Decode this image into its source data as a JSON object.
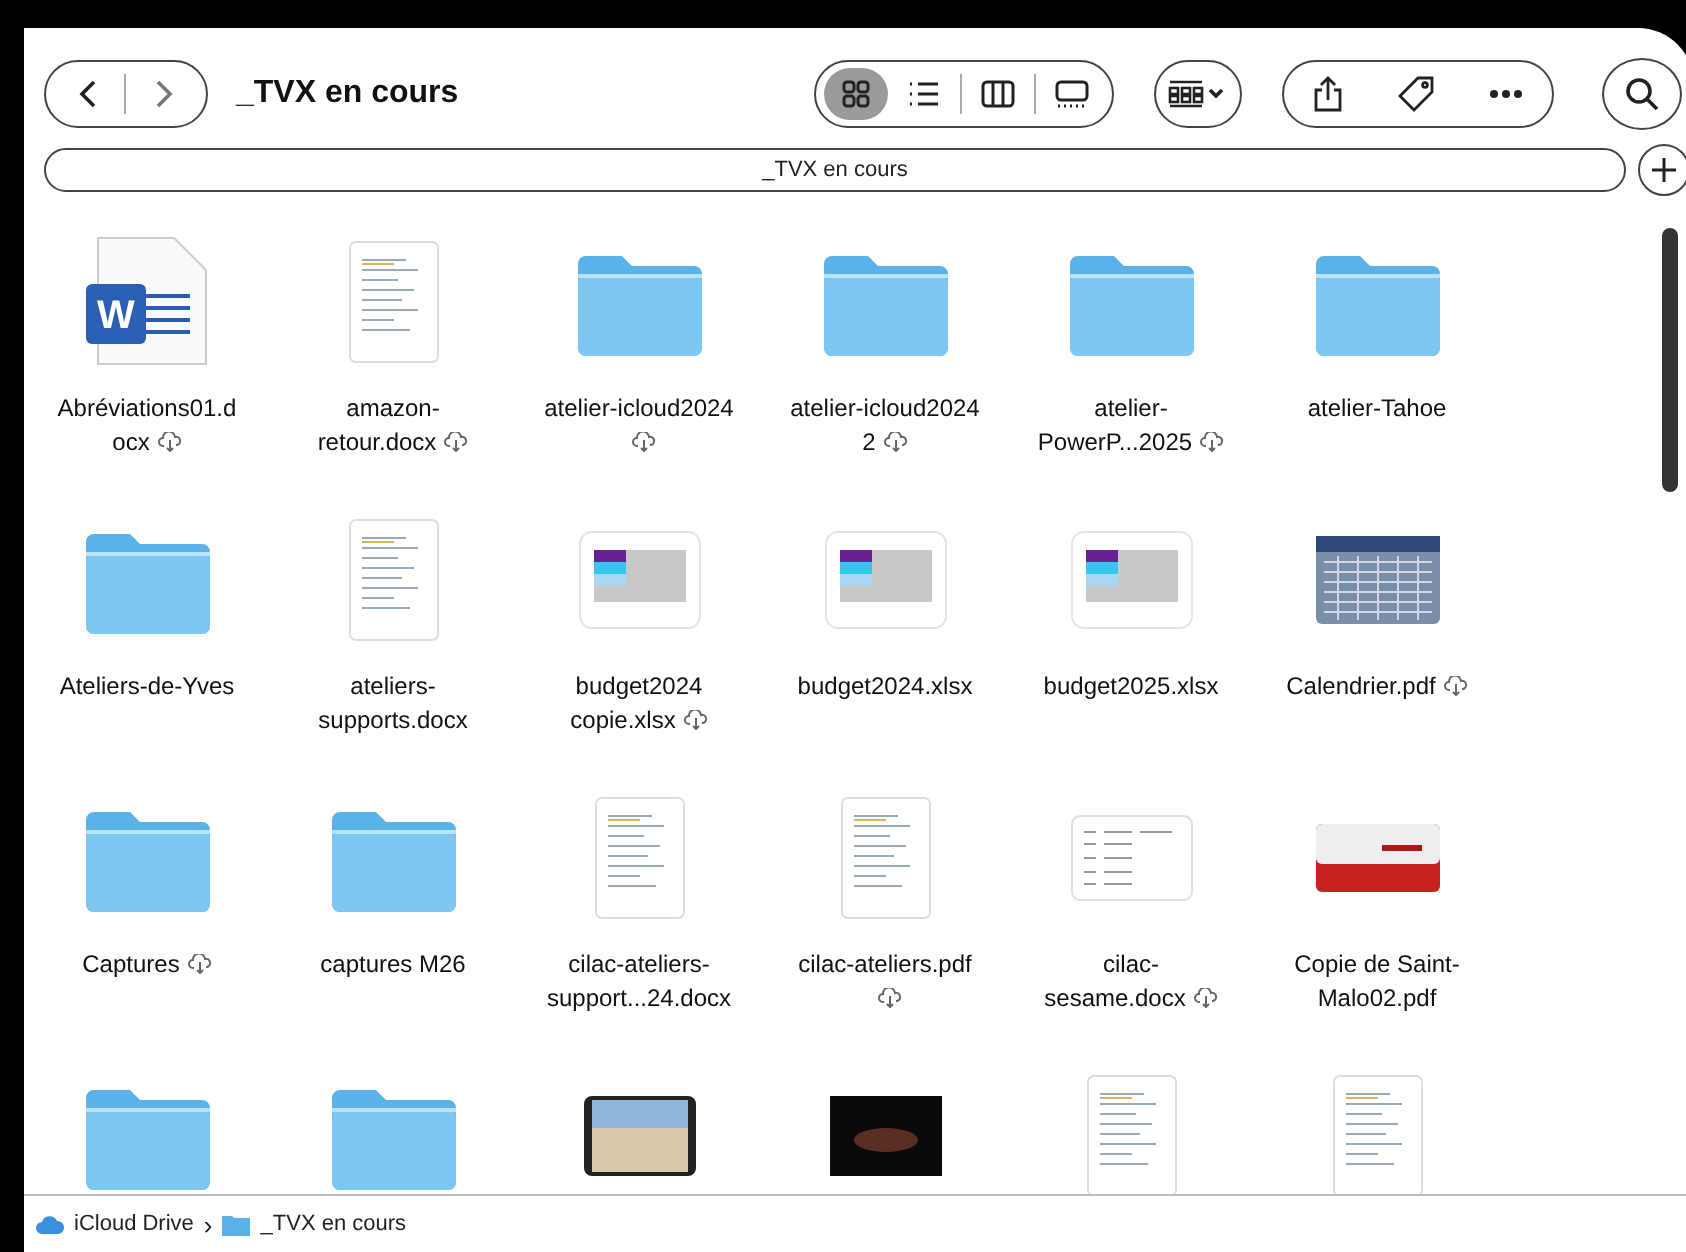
{
  "window": {
    "title": "_TVX en cours"
  },
  "views": [
    {
      "kind": "grid",
      "selected": true
    },
    {
      "kind": "list",
      "selected": false
    },
    {
      "kind": "columns",
      "selected": false
    },
    {
      "kind": "gallery",
      "selected": false
    }
  ],
  "path_field": {
    "value": "_TVX en cours"
  },
  "files": [
    {
      "name": "Abréviations01.docx",
      "kind": "word",
      "icon_letter": "W",
      "cloud": true
    },
    {
      "name": "amazon-retour.docx",
      "kind": "doc",
      "cloud": true
    },
    {
      "name": "atelier-icloud2024",
      "kind": "folder",
      "cloud": true
    },
    {
      "name": "atelier-icloud2024 2",
      "kind": "folder",
      "cloud": true
    },
    {
      "name": "atelier-PowerP...2025",
      "kind": "folder",
      "cloud": true
    },
    {
      "name": "atelier-Tahoe",
      "kind": "folder",
      "cloud": false
    },
    {
      "name": "Ateliers-de-Yves",
      "kind": "folder",
      "cloud": false
    },
    {
      "name": "ateliers-supports.docx",
      "kind": "doc",
      "cloud": false
    },
    {
      "name": "budget2024 copie.xlsx",
      "kind": "sheet",
      "cloud": true
    },
    {
      "name": "budget2024.xlsx",
      "kind": "sheet",
      "cloud": false
    },
    {
      "name": "budget2025.xlsx",
      "kind": "sheet",
      "cloud": false
    },
    {
      "name": "Calendrier.pdf",
      "kind": "calendar",
      "cloud": true
    },
    {
      "name": "Captures",
      "kind": "folder",
      "cloud": true
    },
    {
      "name": "captures M26",
      "kind": "folder",
      "cloud": false
    },
    {
      "name": "cilac-ateliers-support...24.docx",
      "kind": "doc",
      "cloud": false
    },
    {
      "name": "cilac-ateliers.pdf",
      "kind": "doc",
      "cloud": true
    },
    {
      "name": "cilac-sesame.docx",
      "kind": "wide",
      "cloud": true
    },
    {
      "name": "Copie de Saint-Malo02.pdf",
      "kind": "card",
      "cloud": false
    },
    {
      "kind": "folder"
    },
    {
      "kind": "folder"
    },
    {
      "kind": "photo"
    },
    {
      "kind": "dark"
    },
    {
      "kind": "doc"
    },
    {
      "kind": "doc"
    }
  ],
  "path_separator": "›",
  "path_bar": [
    {
      "kind": "cloud",
      "label": "iCloud Drive"
    },
    {
      "kind": "folder",
      "label": "_TVX en cours"
    }
  ]
}
